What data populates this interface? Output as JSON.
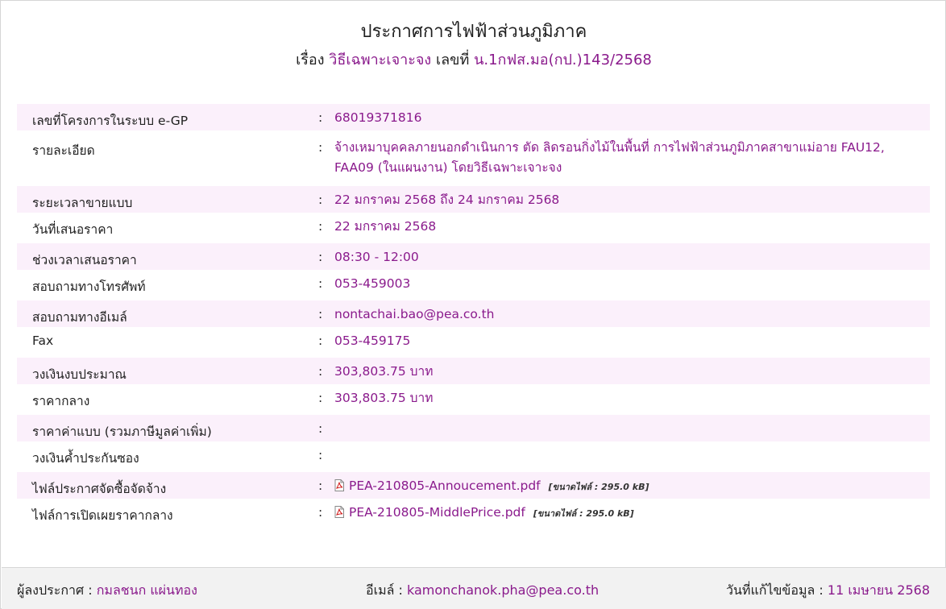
{
  "header": {
    "title": "ประกาศการไฟฟ้าส่วนภูมิภาค",
    "subject_prefix": "เรื่อง",
    "method": "วิธีเฉพาะเจาะจง",
    "number_prefix": "เลขที่",
    "number": "น.1กฟส.มอ(กป.)143/2568"
  },
  "details": {
    "colon": ":",
    "rows": [
      {
        "label": "เลขที่โครงการในระบบ e-GP",
        "value": "68019371816"
      },
      {
        "label": "รายละเอียด",
        "value": "จ้างเหมาบุคคลภายนอกดำเนินการ ตัด ลิดรอนกิ่งไม้ในพื้นที่ การไฟฟ้าส่วนภูมิภาคสาขาแม่อาย FAU12, FAA09 (ในแผนงาน) โดยวิธีเฉพาะเจาะจง"
      },
      {
        "label": "ระยะเวลาขายแบบ",
        "value": "22 มกราคม 2568 ถึง 24 มกราคม 2568"
      },
      {
        "label": "วันที่เสนอราคา",
        "value": "22 มกราคม 2568"
      },
      {
        "label": "ช่วงเวลาเสนอราคา",
        "value": "08:30 - 12:00"
      },
      {
        "label": "สอบถามทางโทรศัพท์",
        "value": "053-459003"
      },
      {
        "label": "สอบถามทางอีเมล์",
        "value": "nontachai.bao@pea.co.th"
      },
      {
        "label": "Fax",
        "value": "053-459175"
      },
      {
        "label": "วงเงินงบประมาณ",
        "value": "303,803.75 บาท"
      },
      {
        "label": "ราคากลาง",
        "value": "303,803.75 บาท"
      },
      {
        "label": "ราคาค่าแบบ (รวมภาษีมูลค่าเพิ่ม)",
        "value": ""
      },
      {
        "label": "วงเงินค้ำประกันซอง",
        "value": ""
      },
      {
        "label": "ไฟล์ประกาศจัดซื้อจัดจ้าง",
        "file": "PEA-210805-Annoucement.pdf",
        "size": "[ขนาดไฟล์ : 295.0 kB]",
        "icon": "pdf-icon"
      },
      {
        "label": "ไฟล์การเปิดเผยราคากลาง",
        "file": "PEA-210805-MiddlePrice.pdf",
        "size": "[ขนาดไฟล์ : 295.0 kB]",
        "icon": "pdf-icon"
      }
    ]
  },
  "footer": {
    "announcer_label": "ผู้ลงประกาศ :",
    "announcer": "กมลชนก แผ่นทอง",
    "email_label": "อีเมล์ :",
    "email": "kamonchanok.pha@pea.co.th",
    "edited_label": "วันที่แก้ไขข้อมูล :",
    "edited": "11 เมษายน 2568"
  },
  "colors": {
    "accent": "#8a1a8c",
    "row_alt": "#fbf0fb",
    "footer_bg": "#f2f2f2"
  }
}
